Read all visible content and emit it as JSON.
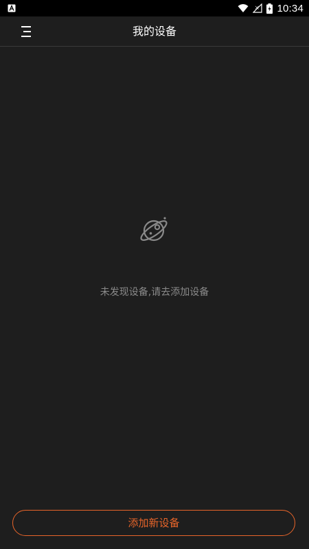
{
  "status_bar": {
    "time": "10:34",
    "left_icon": "a-notification-icon",
    "icons": [
      "wifi-icon",
      "signal-icon",
      "battery-charging-icon"
    ]
  },
  "header": {
    "title": "我的设备",
    "menu_icon": "menu-icon"
  },
  "empty_state": {
    "icon": "planet-icon",
    "message": "未发现设备,请去添加设备"
  },
  "footer": {
    "add_button_label": "添加新设备"
  },
  "colors": {
    "background": "#1e1e1e",
    "accent": "#e8652a",
    "muted_text": "#8a8a8a",
    "status_bar": "#000000"
  }
}
